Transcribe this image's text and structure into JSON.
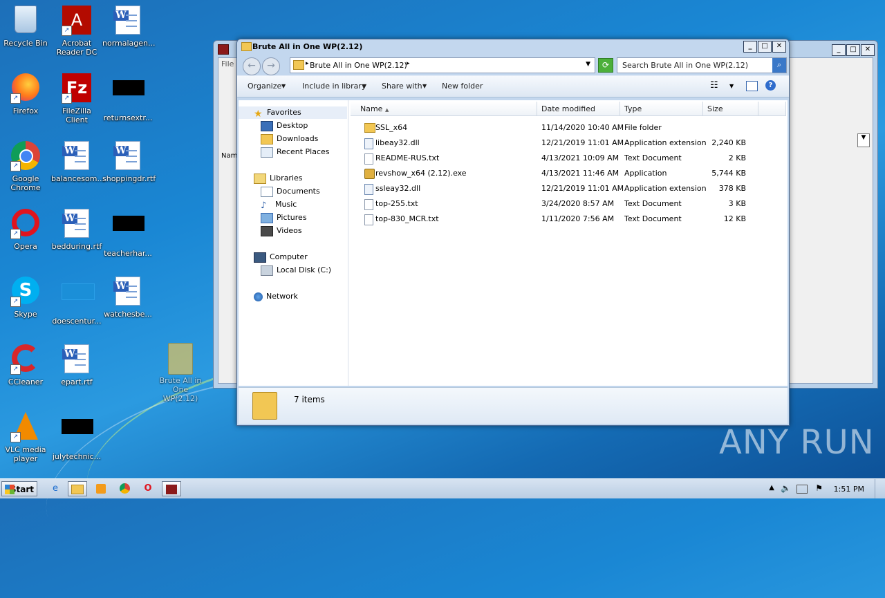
{
  "desktop": {
    "icons": [
      {
        "label": "Recycle Bin"
      },
      {
        "label": "Acrobat Reader DC"
      },
      {
        "label": "normalagen..."
      },
      {
        "label": "Firefox"
      },
      {
        "label": "FileZilla Client"
      },
      {
        "label": "returnsextr..."
      },
      {
        "label": "Google Chrome"
      },
      {
        "label": "balancesom..."
      },
      {
        "label": "shoppingdr.rtf"
      },
      {
        "label": "Opera"
      },
      {
        "label": "bedduring.rtf"
      },
      {
        "label": "teacherhar..."
      },
      {
        "label": "Skype"
      },
      {
        "label": "doescentur..."
      },
      {
        "label": "watchesbe..."
      },
      {
        "label": "CCleaner"
      },
      {
        "label": "epart.rtf"
      },
      {
        "label": "Brute All in One WP(2.12)"
      },
      {
        "label": "VLC media player"
      },
      {
        "label": "julytechnic..."
      }
    ]
  },
  "back_window": {
    "menu_file": "File",
    "col_name": "Nam"
  },
  "window": {
    "title": "Brute All in One WP(2.12)",
    "address_crumb": "Brute All in One WP(2.12)",
    "search_placeholder": "Search Brute All in One WP(2.12)",
    "toolbar": {
      "organize": "Organize",
      "include_in_library": "Include in library",
      "share_with": "Share with",
      "new_folder": "New folder"
    },
    "nav": {
      "favorites": "Favorites",
      "desktop": "Desktop",
      "downloads": "Downloads",
      "recent_places": "Recent Places",
      "libraries": "Libraries",
      "documents": "Documents",
      "music": "Music",
      "pictures": "Pictures",
      "videos": "Videos",
      "computer": "Computer",
      "local_disk": "Local Disk (C:)",
      "network": "Network"
    },
    "columns": {
      "name": "Name",
      "date_modified": "Date modified",
      "type": "Type",
      "size": "Size"
    },
    "files": [
      {
        "name": "SSL_x64",
        "date": "11/14/2020 10:40 AM",
        "type": "File folder",
        "size": "",
        "icon": "folder"
      },
      {
        "name": "libeay32.dll",
        "date": "12/21/2019 11:01 AM",
        "type": "Application extension",
        "size": "2,240 KB",
        "icon": "dll"
      },
      {
        "name": "README-RUS.txt",
        "date": "4/13/2021 10:09 AM",
        "type": "Text Document",
        "size": "2 KB",
        "icon": "file"
      },
      {
        "name": "revshow_x64 (2.12).exe",
        "date": "4/13/2021 11:46 AM",
        "type": "Application",
        "size": "5,744 KB",
        "icon": "exe"
      },
      {
        "name": "ssleay32.dll",
        "date": "12/21/2019 11:01 AM",
        "type": "Application extension",
        "size": "378 KB",
        "icon": "dll"
      },
      {
        "name": "top-255.txt",
        "date": "3/24/2020 8:57 AM",
        "type": "Text Document",
        "size": "3 KB",
        "icon": "file"
      },
      {
        "name": "top-830_MCR.txt",
        "date": "1/11/2020 7:56 AM",
        "type": "Text Document",
        "size": "12 KB",
        "icon": "file"
      }
    ],
    "status": "7 items"
  },
  "taskbar": {
    "start": "Start",
    "clock": "1:51 PM"
  },
  "watermark": "ANY RUN"
}
